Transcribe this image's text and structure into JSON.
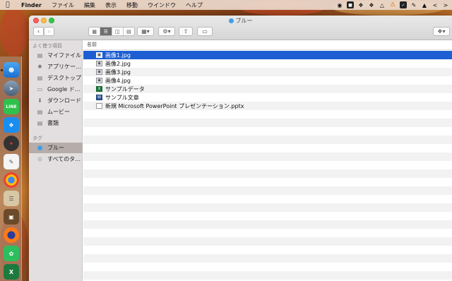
{
  "menubar": {
    "app_name": "Finder",
    "items": [
      "ファイル",
      "編集",
      "表示",
      "移動",
      "ウインドウ",
      "ヘルプ"
    ]
  },
  "window": {
    "title": "ブルー",
    "tag_color": "#3fa0e6"
  },
  "sidebar": {
    "favorites_heading": "よく使う項目",
    "favorites": [
      {
        "label": "マイファイル",
        "icon": "all-files-icon"
      },
      {
        "label": "アプリケー…",
        "icon": "applications-icon"
      },
      {
        "label": "デスクトップ",
        "icon": "desktop-icon"
      },
      {
        "label": "Google ド…",
        "icon": "folder-icon"
      },
      {
        "label": "ダウンロード",
        "icon": "downloads-icon"
      },
      {
        "label": "ムービー",
        "icon": "movies-icon"
      },
      {
        "label": "書類",
        "icon": "documents-icon"
      }
    ],
    "tags_heading": "タグ",
    "tags": [
      {
        "label": "ブルー",
        "color": "#3fa0e6",
        "selected": true
      },
      {
        "label": "すべてのタ…",
        "color": "#c8c8c8",
        "selected": false
      }
    ]
  },
  "list": {
    "column_name": "名前",
    "files": [
      {
        "name": "画像1.jpg",
        "icon": "image-file-icon",
        "selected": true
      },
      {
        "name": "画像2.jpg",
        "icon": "image-file-icon",
        "selected": false
      },
      {
        "name": "画像3.jpg",
        "icon": "image-file-icon",
        "selected": false
      },
      {
        "name": "画像4.jpg",
        "icon": "image-file-icon",
        "selected": false
      },
      {
        "name": "サンプルデータ",
        "icon": "excel-file-icon",
        "selected": false
      },
      {
        "name": "サンプル文章",
        "icon": "word-file-icon",
        "selected": false
      },
      {
        "name": "新規 Microsoft PowerPoint プレゼンテーション.pptx",
        "icon": "powerpoint-file-icon",
        "selected": false
      }
    ]
  },
  "colors": {
    "selection": "#1d5fd3",
    "sidebar_bg": "#e3dfe0",
    "sidebar_selected": "#b6adab"
  }
}
